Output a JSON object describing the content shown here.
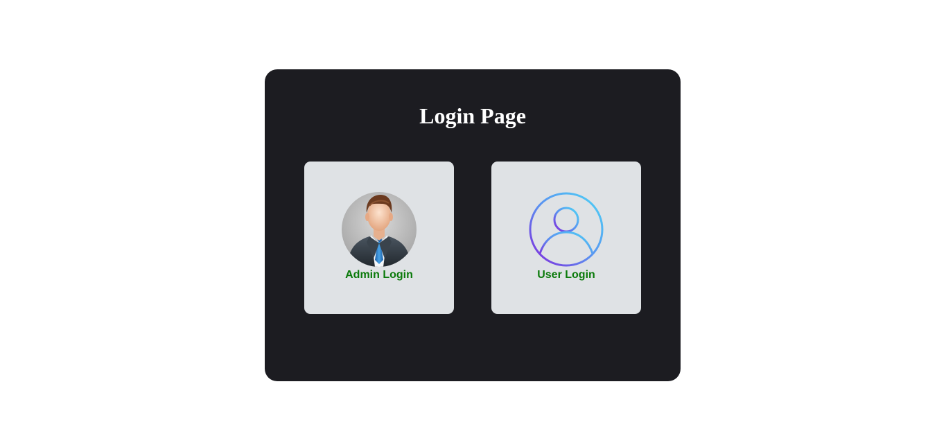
{
  "page": {
    "title": "Login Page"
  },
  "cards": [
    {
      "label": "Admin Login",
      "icon": "admin-avatar-icon"
    },
    {
      "label": "User Login",
      "icon": "user-outline-icon"
    }
  ],
  "colors": {
    "panel_bg": "#1c1c21",
    "card_bg": "#dfe2e5",
    "label_green": "#0a7a0a",
    "title_white": "#ffffff"
  }
}
